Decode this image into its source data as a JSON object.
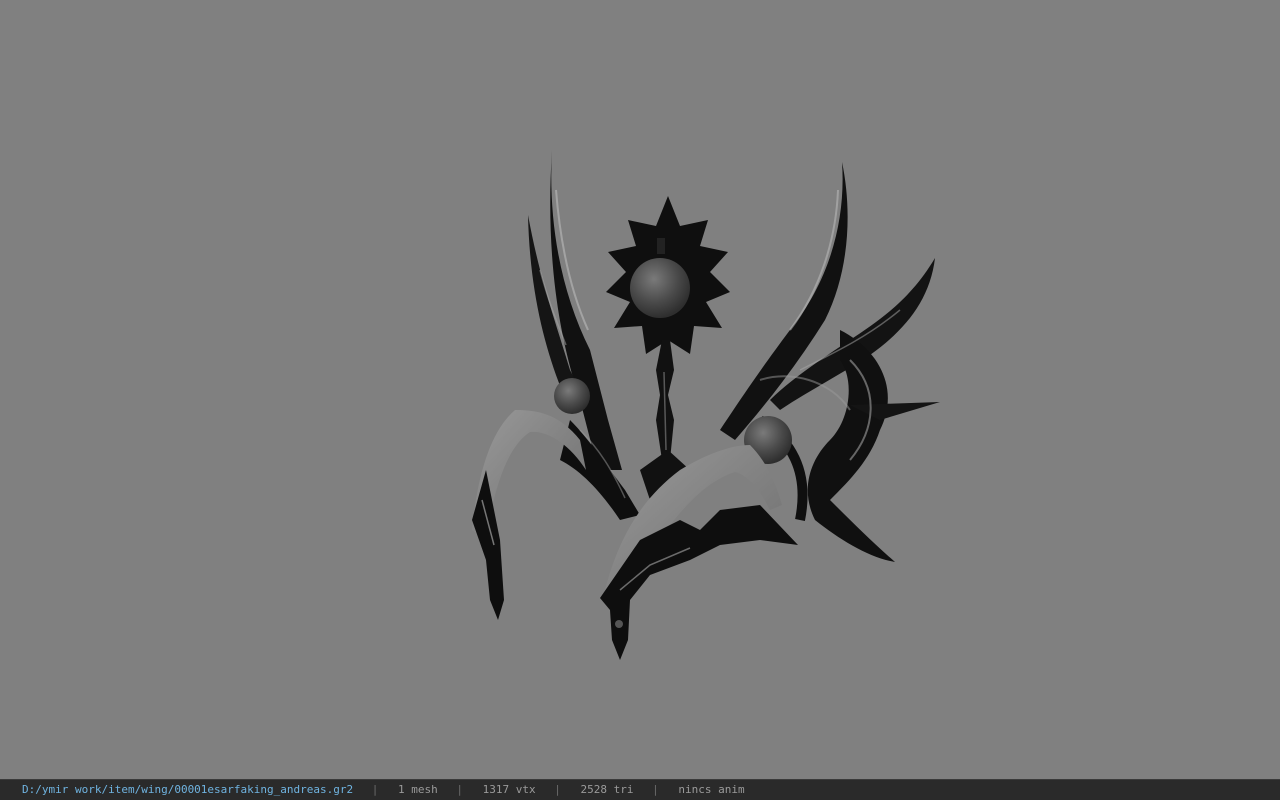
{
  "viewport": {
    "background": "#808080",
    "model_tint": "#0d0d0d",
    "highlight": "#bdbdbd",
    "ribbon": "#8a8a8a"
  },
  "status": {
    "path": "D:/ymir work/item/wing/00001esarfaking_andreas.gr2",
    "separator": "|",
    "mesh": "1 mesh",
    "vertices": "1317 vtx",
    "triangles": "2528 tri",
    "animation": "nincs anim"
  }
}
